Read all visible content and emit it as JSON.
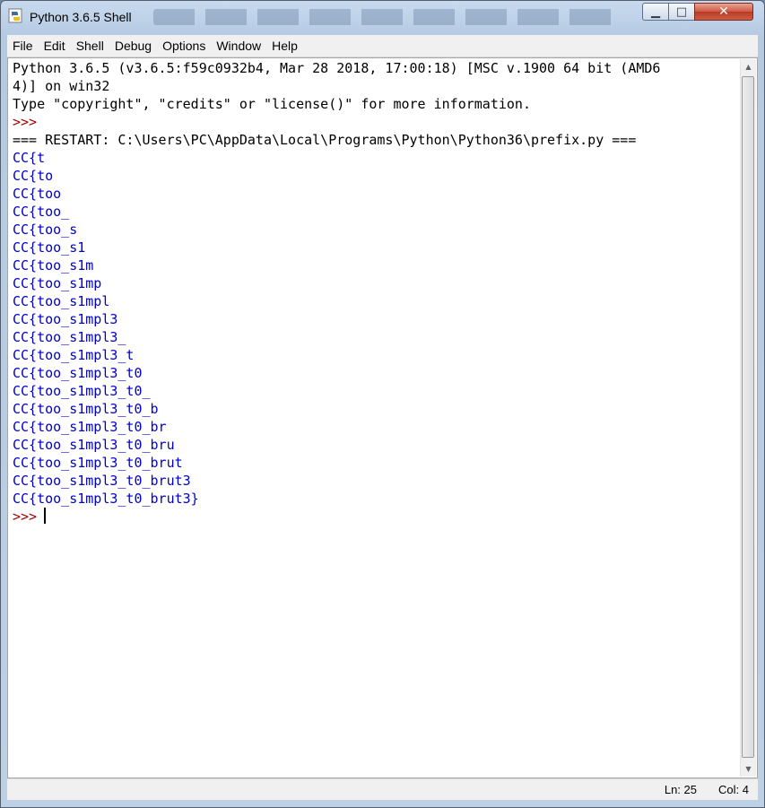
{
  "window": {
    "title": "Python 3.6.5 Shell"
  },
  "menu": [
    "File",
    "Edit",
    "Shell",
    "Debug",
    "Options",
    "Window",
    "Help"
  ],
  "shell": {
    "lines": [
      {
        "text": "Python 3.6.5 (v3.6.5:f59c0932b4, Mar 28 2018, 17:00:18) [MSC v.1900 64 bit (AMD6",
        "kind": "plain"
      },
      {
        "text": "4)] on win32",
        "kind": "plain"
      },
      {
        "text": "Type \"copyright\", \"credits\" or \"license()\" for more information.",
        "kind": "plain"
      },
      {
        "text": ">>> ",
        "kind": "prompt"
      },
      {
        "text": "=== RESTART: C:\\Users\\PC\\AppData\\Local\\Programs\\Python\\Python36\\prefix.py ===",
        "kind": "restart"
      },
      {
        "text": "CC{t",
        "kind": "stdout"
      },
      {
        "text": "CC{to",
        "kind": "stdout"
      },
      {
        "text": "CC{too",
        "kind": "stdout"
      },
      {
        "text": "CC{too_",
        "kind": "stdout"
      },
      {
        "text": "CC{too_s",
        "kind": "stdout"
      },
      {
        "text": "CC{too_s1",
        "kind": "stdout"
      },
      {
        "text": "CC{too_s1m",
        "kind": "stdout"
      },
      {
        "text": "CC{too_s1mp",
        "kind": "stdout"
      },
      {
        "text": "CC{too_s1mpl",
        "kind": "stdout"
      },
      {
        "text": "CC{too_s1mpl3",
        "kind": "stdout"
      },
      {
        "text": "CC{too_s1mpl3_",
        "kind": "stdout"
      },
      {
        "text": "CC{too_s1mpl3_t",
        "kind": "stdout"
      },
      {
        "text": "CC{too_s1mpl3_t0",
        "kind": "stdout"
      },
      {
        "text": "CC{too_s1mpl3_t0_",
        "kind": "stdout"
      },
      {
        "text": "CC{too_s1mpl3_t0_b",
        "kind": "stdout"
      },
      {
        "text": "CC{too_s1mpl3_t0_br",
        "kind": "stdout"
      },
      {
        "text": "CC{too_s1mpl3_t0_bru",
        "kind": "stdout"
      },
      {
        "text": "CC{too_s1mpl3_t0_brut",
        "kind": "stdout"
      },
      {
        "text": "CC{too_s1mpl3_t0_brut3",
        "kind": "stdout"
      },
      {
        "text": "CC{too_s1mpl3_t0_brut3}",
        "kind": "stdout"
      }
    ],
    "current_prompt": ">>>"
  },
  "status": {
    "ln": "Ln: 25",
    "col": "Col: 4"
  },
  "colors": {
    "stdout": "#0000cc",
    "prompt": "#a40000",
    "text": "#000000"
  },
  "icons": [
    "python-icon",
    "minimize-icon",
    "maximize-icon",
    "close-icon",
    "scroll-up-arrow-icon",
    "scroll-down-arrow-icon"
  ]
}
